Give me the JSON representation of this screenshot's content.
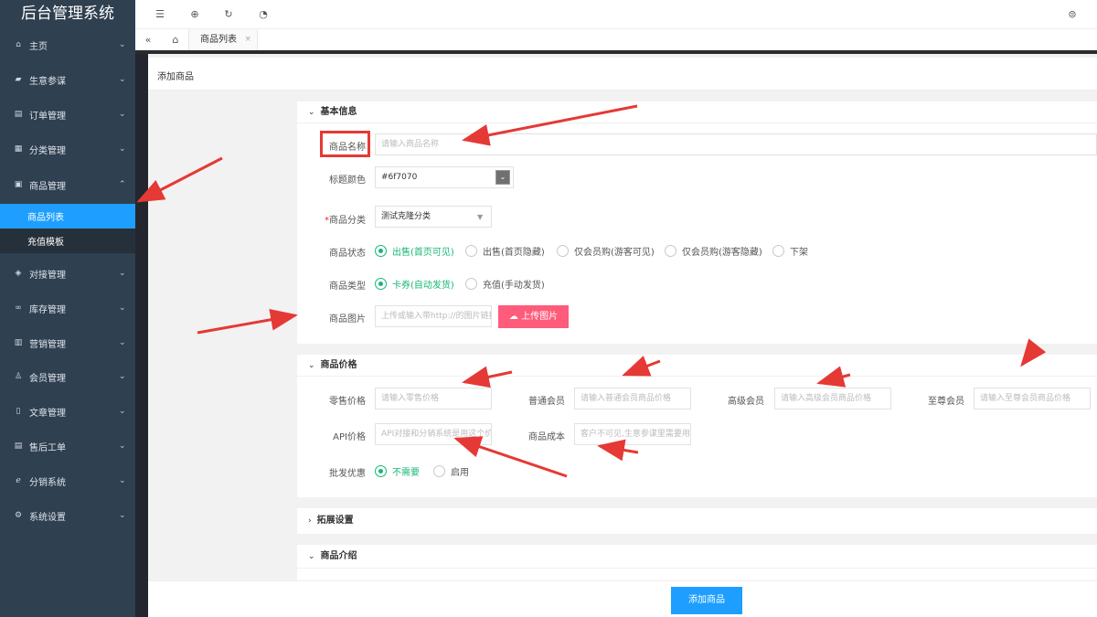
{
  "app": {
    "title": "后台管理系统"
  },
  "sidebar": {
    "items": [
      {
        "label": "主页",
        "icon": "home-icon",
        "glyph": "⌂",
        "chevron": "⌄"
      },
      {
        "label": "生意参谋",
        "icon": "briefcase-icon",
        "glyph": "▰",
        "chevron": "⌄"
      },
      {
        "label": "订单管理",
        "icon": "document-icon",
        "glyph": "▤",
        "chevron": "⌄"
      },
      {
        "label": "分类管理",
        "icon": "grid-icon",
        "glyph": "▦",
        "chevron": "⌄"
      },
      {
        "label": "商品管理",
        "icon": "goods-icon",
        "glyph": "▣",
        "chevron": "⌃"
      },
      {
        "label": "对接管理",
        "icon": "shield-icon",
        "glyph": "◈",
        "chevron": "⌄"
      },
      {
        "label": "库存管理",
        "icon": "link-icon",
        "glyph": "∞",
        "chevron": "⌄"
      },
      {
        "label": "营销管理",
        "icon": "calendar-icon",
        "glyph": "▥",
        "chevron": "⌄"
      },
      {
        "label": "会员管理",
        "icon": "user-icon",
        "glyph": "♙",
        "chevron": "⌄"
      },
      {
        "label": "文章管理",
        "icon": "file-icon",
        "glyph": "▯",
        "chevron": "⌄"
      },
      {
        "label": "售后工单",
        "icon": "ticket-icon",
        "glyph": "▤",
        "chevron": "⌄"
      },
      {
        "label": "分销系统",
        "icon": "distribution-icon",
        "glyph": "ℯ",
        "chevron": "⌄"
      },
      {
        "label": "系统设置",
        "icon": "gear-icon",
        "glyph": "⚙",
        "chevron": "⌄"
      }
    ],
    "sub": [
      {
        "label": "商品列表",
        "active": true
      },
      {
        "label": "充值模板",
        "active": false
      }
    ]
  },
  "topbar": {
    "icons": [
      {
        "name": "menu-toggle-icon",
        "glyph": "☰"
      },
      {
        "name": "globe-icon",
        "glyph": "⊕"
      },
      {
        "name": "refresh-icon",
        "glyph": "↻"
      },
      {
        "name": "dashboard-icon",
        "glyph": "◔"
      },
      {
        "name": "theme-icon",
        "glyph": "⊜"
      }
    ]
  },
  "tabs": {
    "collapse": "«",
    "home": "⌂",
    "items": [
      {
        "label": "商品列表",
        "close": "×"
      }
    ]
  },
  "page": {
    "title": "添加商品"
  },
  "basic": {
    "header": "基本信息",
    "chevron": "⌄",
    "name": {
      "label": "商品名称",
      "placeholder": "请输入商品名称"
    },
    "color": {
      "label": "标题颜色",
      "value": "#6f7070",
      "swatch": "#6f7070",
      "swatch_glyph": "⌄"
    },
    "category": {
      "label": "商品分类",
      "required_mark": "*",
      "value": "测试克隆分类",
      "arrow": "▼"
    },
    "status": {
      "label": "商品状态",
      "options": [
        "出售(首页可见)",
        "出售(首页隐藏)",
        "仅会员购(游客可见)",
        "仅会员购(游客隐藏)",
        "下架"
      ],
      "selected": 0
    },
    "type": {
      "label": "商品类型",
      "options": [
        "卡券(自动发货)",
        "充值(手动发货)"
      ],
      "selected": 0
    },
    "image": {
      "label": "商品图片",
      "placeholder": "上传或输入带http://的图片链接",
      "upload_label": "上传图片",
      "upload_icon": "☁"
    }
  },
  "price": {
    "header": "商品价格",
    "chevron": "⌄",
    "retail": {
      "label": "零售价格",
      "placeholder": "请输入零售价格"
    },
    "normal": {
      "label": "普通会员",
      "placeholder": "请输入普通会员商品价格"
    },
    "senior": {
      "label": "高级会员",
      "placeholder": "请输入高级会员商品价格"
    },
    "supreme": {
      "label": "至尊会员",
      "placeholder": "请输入至尊会员商品价格"
    },
    "api": {
      "label": "API价格",
      "placeholder": "API对接和分销系统是用这个价格"
    },
    "cost": {
      "label": "商品成本",
      "placeholder": "客户不可见,生意参谋里需要用"
    },
    "wholesale": {
      "label": "批发优惠",
      "options": [
        "不需要",
        "启用"
      ],
      "selected": 0
    }
  },
  "extend": {
    "header": "拓展设置",
    "chevron": "›"
  },
  "intro": {
    "header": "商品介绍",
    "chevron": "⌄"
  },
  "submit": {
    "label": "添加商品"
  },
  "colors": {
    "sidebar_bg": "#2f4050",
    "active": "#1e9fff",
    "radio_on": "#16b777",
    "upload": "#ff5b7a",
    "annotation": "#e53935"
  }
}
